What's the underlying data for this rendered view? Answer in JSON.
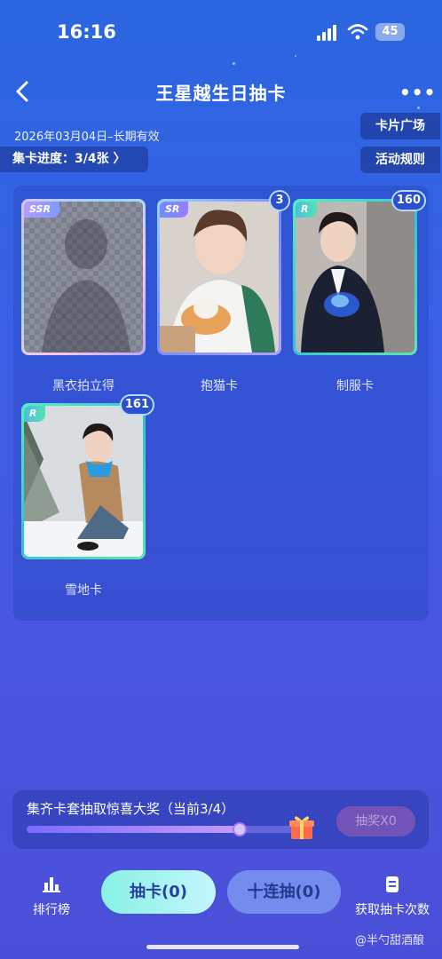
{
  "status_bar": {
    "time": "16:16",
    "battery": "45"
  },
  "header": {
    "title": "王星越生日抽卡",
    "more": "•••"
  },
  "validity": "2026年03月04日–长期有效",
  "collect_progress": "集卡进度：3/4张 〉",
  "side_buttons": {
    "square": "卡片广场",
    "rules": "活动规则"
  },
  "cards": [
    {
      "rarity": "SSR",
      "label": "黑衣拍立得",
      "count": ""
    },
    {
      "rarity": "SR",
      "label": "抱猫卡",
      "count": "3"
    },
    {
      "rarity": "R",
      "label": "制服卡",
      "count": "160"
    },
    {
      "rarity": "R",
      "label": "雪地卡",
      "count": "161"
    }
  ],
  "prize": {
    "title": "集齐卡套抽取惊喜大奖（当前3/4）",
    "progress_fraction": 0.75,
    "lottery_button": "抽奖X0"
  },
  "bottom": {
    "rank_label": "排行榜",
    "draw_button": "抽卡(0)",
    "ten_draw_button": "十连抽(0)",
    "get_count_label": "获取抽卡次数"
  },
  "watermark": "@半勺甜酒酿",
  "colors": {
    "accent": "#4a55e0",
    "draw_button": "#88f1e4",
    "r_frame": "#52f0c8"
  }
}
